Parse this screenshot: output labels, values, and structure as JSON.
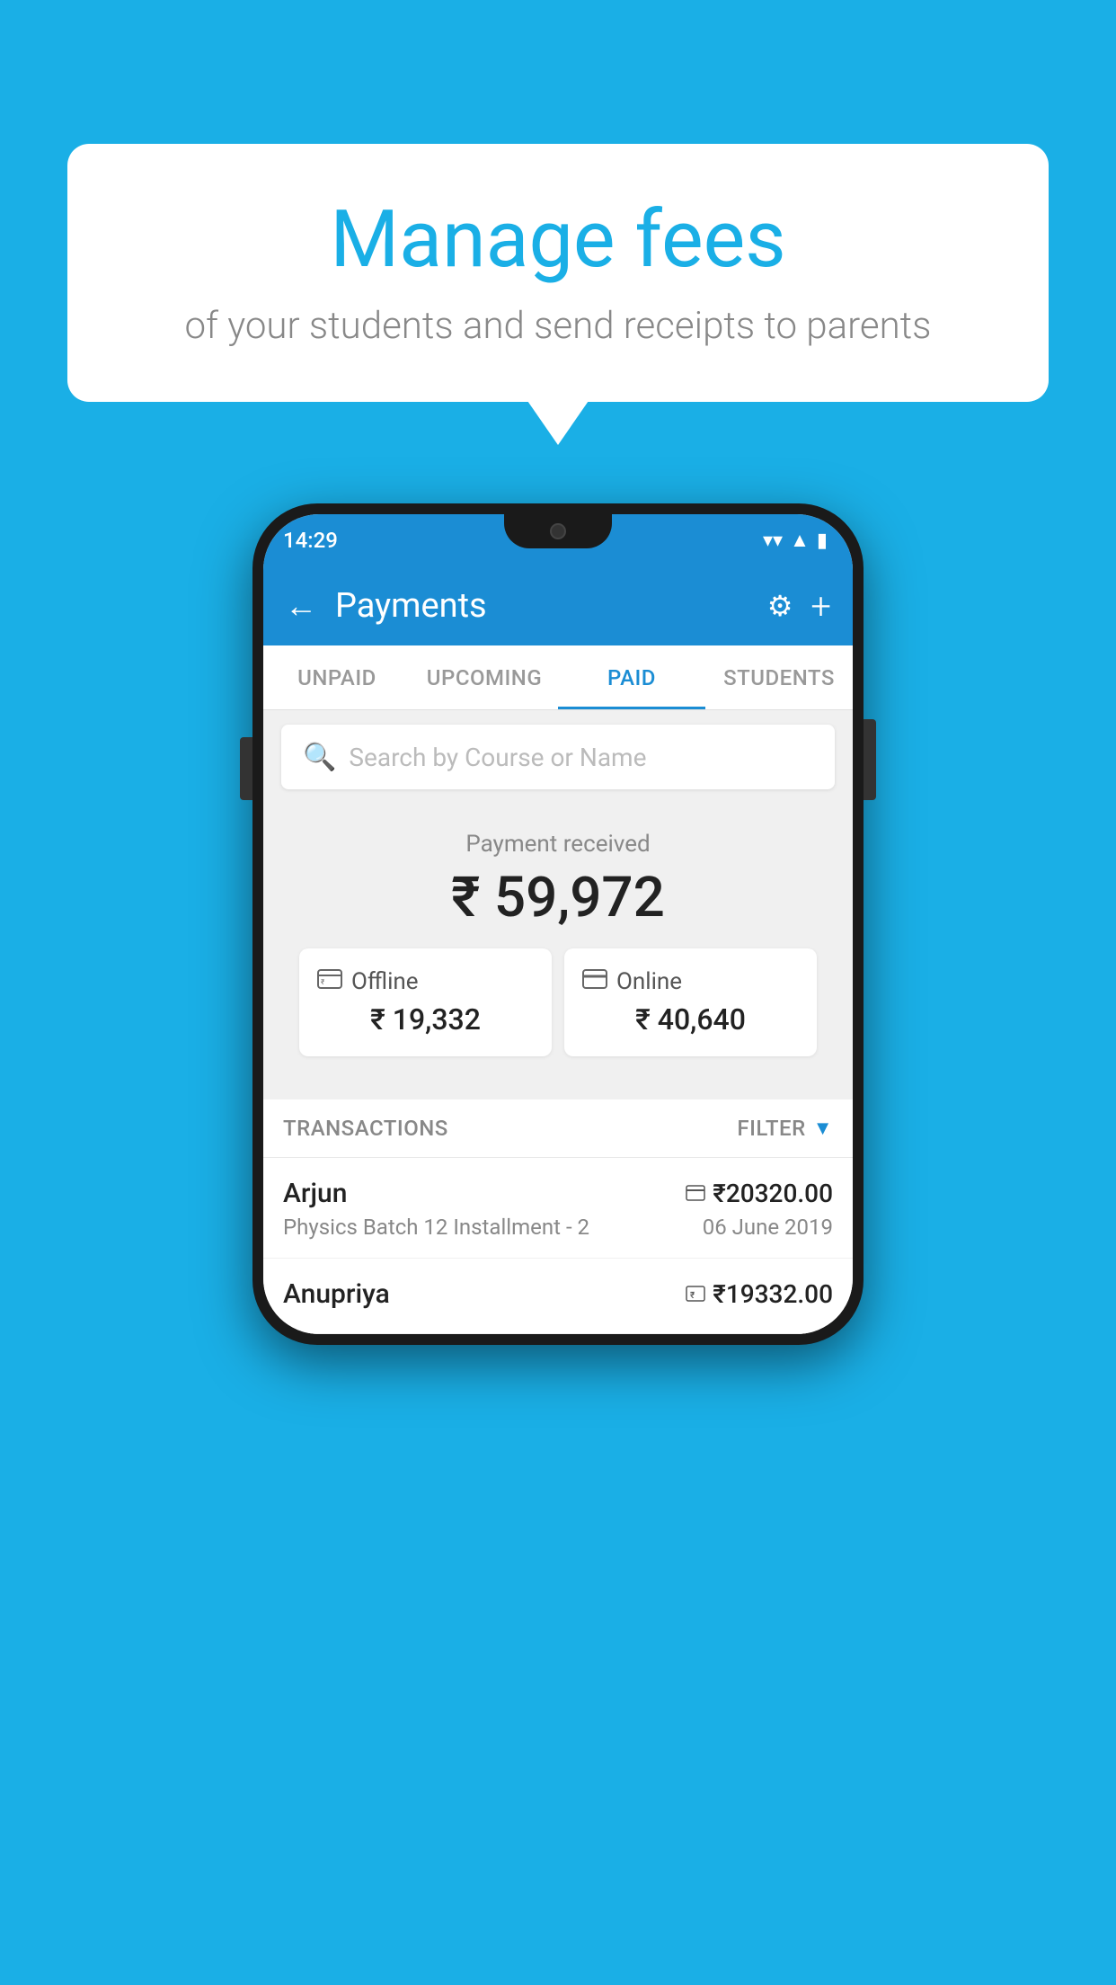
{
  "background_color": "#1aafe6",
  "speech_bubble": {
    "title": "Manage fees",
    "subtitle": "of your students and send receipts to parents"
  },
  "status_bar": {
    "time": "14:29",
    "wifi_icon": "▾",
    "signal_icon": "▲",
    "battery_icon": "▮"
  },
  "app_bar": {
    "title": "Payments",
    "back_icon": "←",
    "settings_icon": "⚙",
    "add_icon": "+"
  },
  "tabs": [
    {
      "label": "UNPAID",
      "active": false
    },
    {
      "label": "UPCOMING",
      "active": false
    },
    {
      "label": "PAID",
      "active": true
    },
    {
      "label": "STUDENTS",
      "active": false
    }
  ],
  "search": {
    "placeholder": "Search by Course or Name"
  },
  "payment_received": {
    "label": "Payment received",
    "amount": "₹ 59,972"
  },
  "payment_cards": [
    {
      "icon": "₹",
      "type": "Offline",
      "amount": "₹ 19,332"
    },
    {
      "icon": "▬",
      "type": "Online",
      "amount": "₹ 40,640"
    }
  ],
  "transactions": {
    "label": "TRANSACTIONS",
    "filter_label": "FILTER"
  },
  "transaction_rows": [
    {
      "name": "Arjun",
      "icon": "▬",
      "amount": "₹20320.00",
      "course": "Physics Batch 12 Installment - 2",
      "date": "06 June 2019"
    },
    {
      "name": "Anupriya",
      "icon": "₹",
      "amount": "₹19332.00",
      "course": "",
      "date": ""
    }
  ]
}
